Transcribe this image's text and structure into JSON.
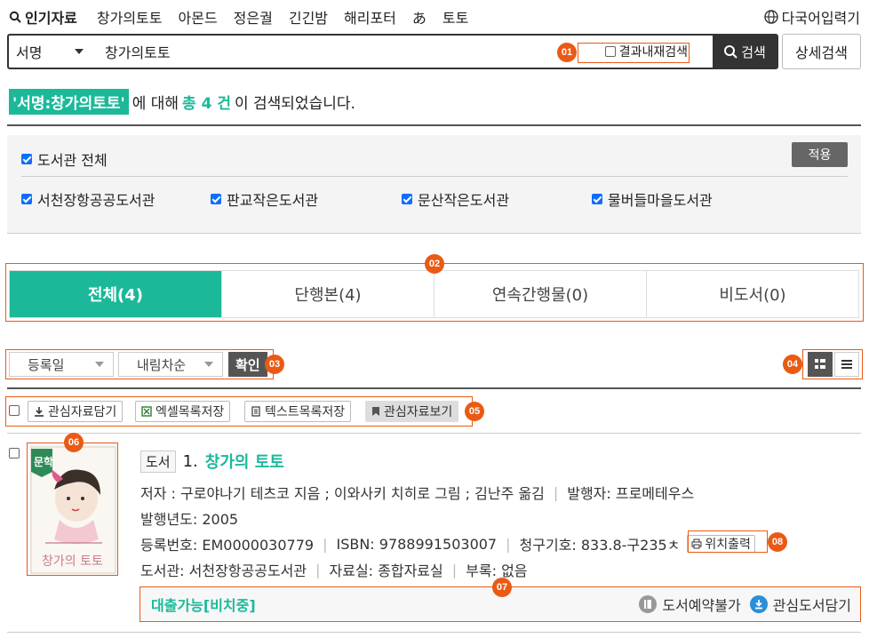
{
  "top": {
    "popular_label": "인기자료",
    "keywords": [
      "창가의토토",
      "아몬드",
      "정은궐",
      "긴긴밤",
      "해리포터",
      "あ",
      "토토"
    ],
    "multilang_label": "다국어입력기"
  },
  "search": {
    "field": "서명",
    "query": "창가의토토",
    "within_label": "결과내재검색",
    "button": "검색",
    "advanced": "상세검색"
  },
  "summary": {
    "highlight": "'서명:창가의토토'",
    "before": "에 대해",
    "count": "총 4 건",
    "after": "이 검색되었습니다."
  },
  "filter": {
    "all_label": "도서관 전체",
    "apply": "적용",
    "libraries": [
      "서천장항공공도서관",
      "판교작은도서관",
      "문산작은도서관",
      "물버들마을도서관"
    ]
  },
  "tabs": [
    "전체(4)",
    "단행본(4)",
    "연속간행물(0)",
    "비도서(0)"
  ],
  "sort": {
    "by": "등록일",
    "order": "내림차순",
    "confirm": "확인"
  },
  "actions": {
    "add": "관심자료담기",
    "excel": "엑셀목록저장",
    "text": "텍스트목록저장",
    "view": "관심자료보기"
  },
  "badges": [
    "01",
    "02",
    "03",
    "04",
    "05",
    "06",
    "07",
    "08"
  ],
  "result": {
    "type": "도서",
    "index": "1.",
    "title": "창가의 토토",
    "author": "저자 : 구로야나기 테츠코 지음 ; 이와사키 치히로 그림 ; 김난주 옮김",
    "publisher": "발행자: 프로메테우스",
    "year": "발행년도: 2005",
    "reg_no": "등록번호: EM0000030779",
    "isbn": "ISBN: 9788991503007",
    "call_no": "청구기호: 833.8-구235ㅊ",
    "location_print": "위치출력",
    "library": "도서관: 서천장항공공도서관",
    "room": "자료실: 종합자료실",
    "appendix": "부록: 없음",
    "availability": "대출가능[비치중]",
    "reserve": "도서예약불가",
    "add_interest": "관심도서담기",
    "cover_tag": "문학",
    "cover_title": "창가의 토토"
  },
  "colors": {
    "accent": "#1bb99a",
    "badge": "#ea5a14"
  }
}
